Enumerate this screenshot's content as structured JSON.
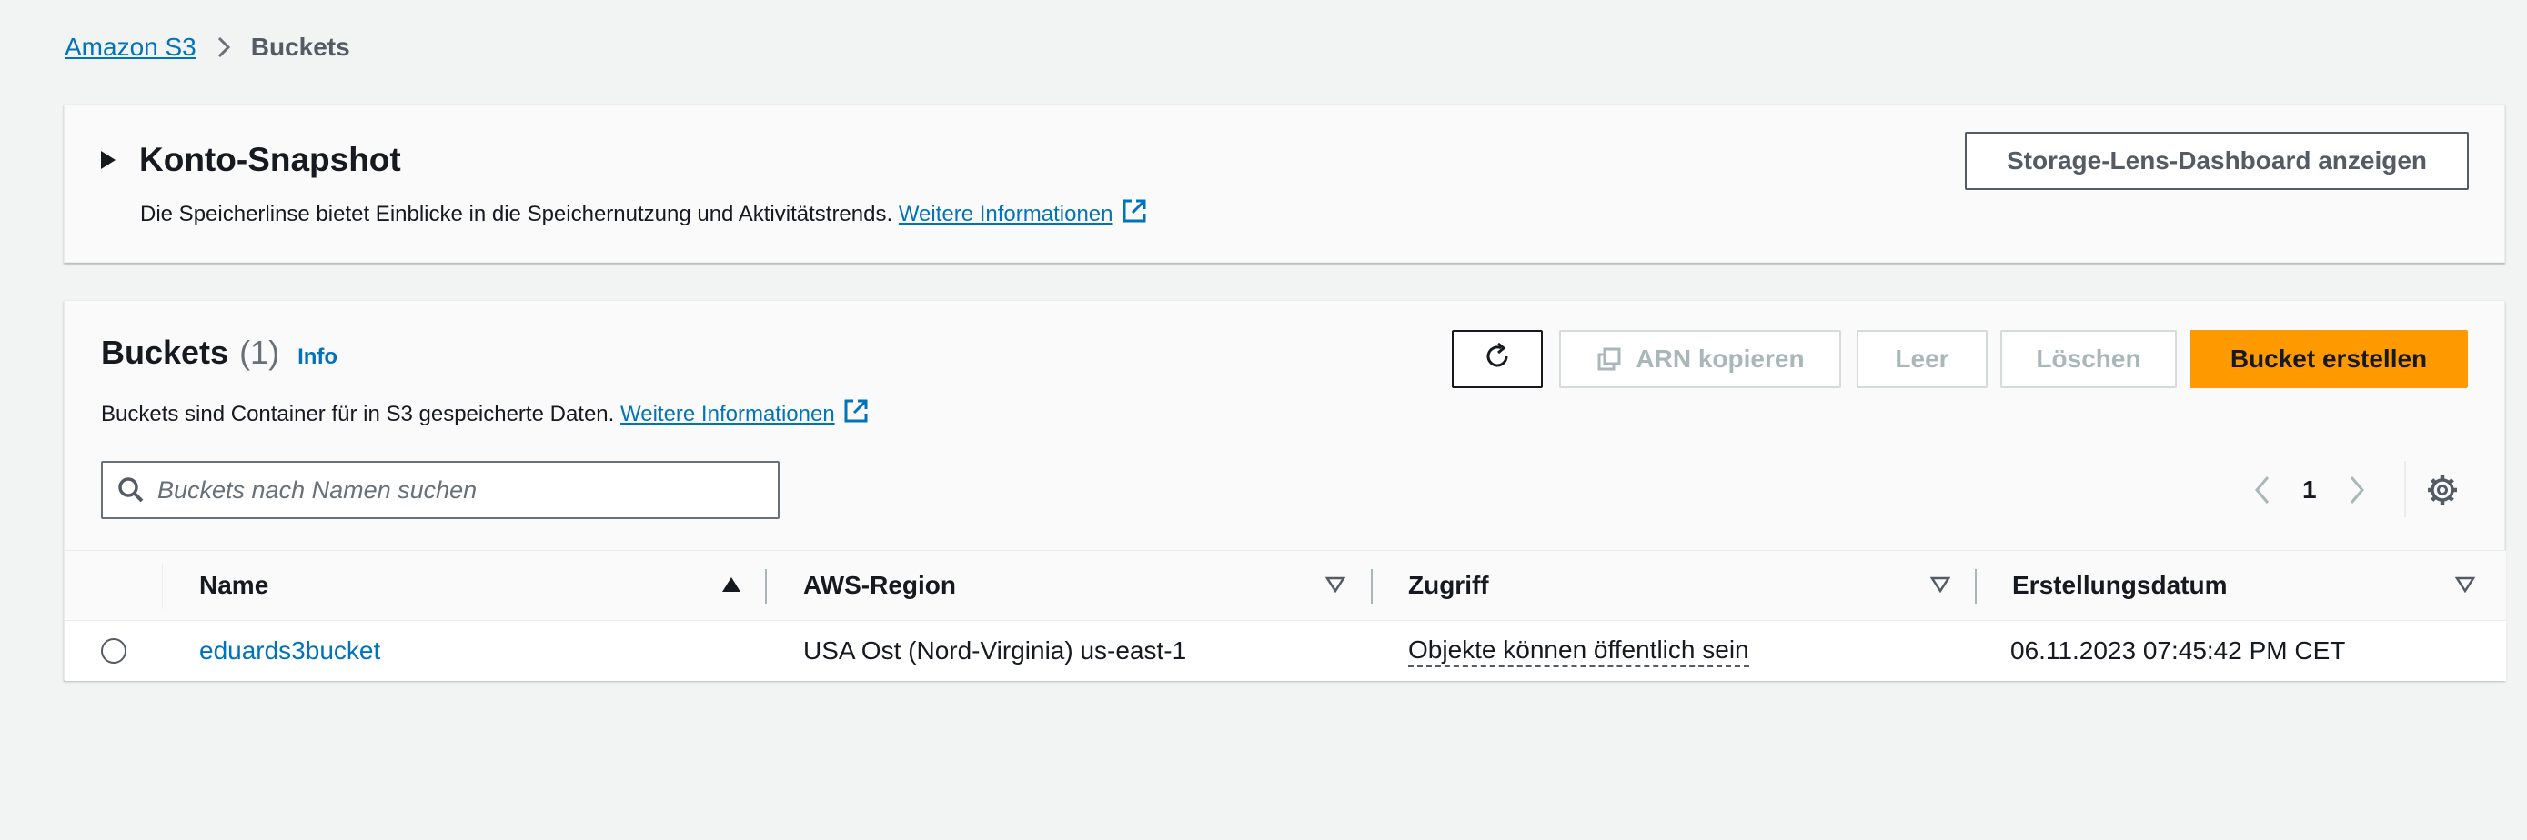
{
  "breadcrumb": {
    "root": "Amazon S3",
    "current": "Buckets"
  },
  "snapshot": {
    "title": "Konto-Snapshot",
    "description": "Die Speicherlinse bietet Einblicke in die Speichernutzung und Aktivitätstrends.",
    "link": "Weitere Informationen",
    "dashboard_button": "Storage-Lens-Dashboard anzeigen"
  },
  "buckets": {
    "title": "Buckets",
    "count": "(1)",
    "info": "Info",
    "description": "Buckets sind Container für in S3 gespeicherte Daten.",
    "link": "Weitere Informationen",
    "actions": {
      "copy_arn": "ARN kopieren",
      "empty": "Leer",
      "delete": "Löschen",
      "create": "Bucket erstellen"
    },
    "search_placeholder": "Buckets nach Namen suchen",
    "page": "1",
    "columns": [
      "Name",
      "AWS-Region",
      "Zugriff",
      "Erstellungsdatum"
    ],
    "rows": [
      {
        "name": "eduards3bucket",
        "region": "USA Ost (Nord-Virginia) us-east-1",
        "access": "Objekte können öffentlich sein",
        "created": "06.11.2023 07:45:42 PM CET"
      }
    ]
  },
  "icons": {
    "breadcrumb_separator": "chevron-right-icon",
    "snapshot_toggle": "caret-right-icon",
    "external_link": "external-link-icon",
    "refresh": "refresh-icon",
    "copy": "copy-icon",
    "search": "search-icon",
    "prev_page": "chevron-left-icon",
    "next_page": "chevron-right-icon",
    "settings": "gear-icon",
    "sort_asc": "sort-ascending-icon",
    "sort": "sort-icon"
  },
  "colors": {
    "page_background": "#f2f3f3",
    "link": "#0073bb",
    "primary_button": "#ff9900",
    "disabled_text": "#aab7b8"
  }
}
